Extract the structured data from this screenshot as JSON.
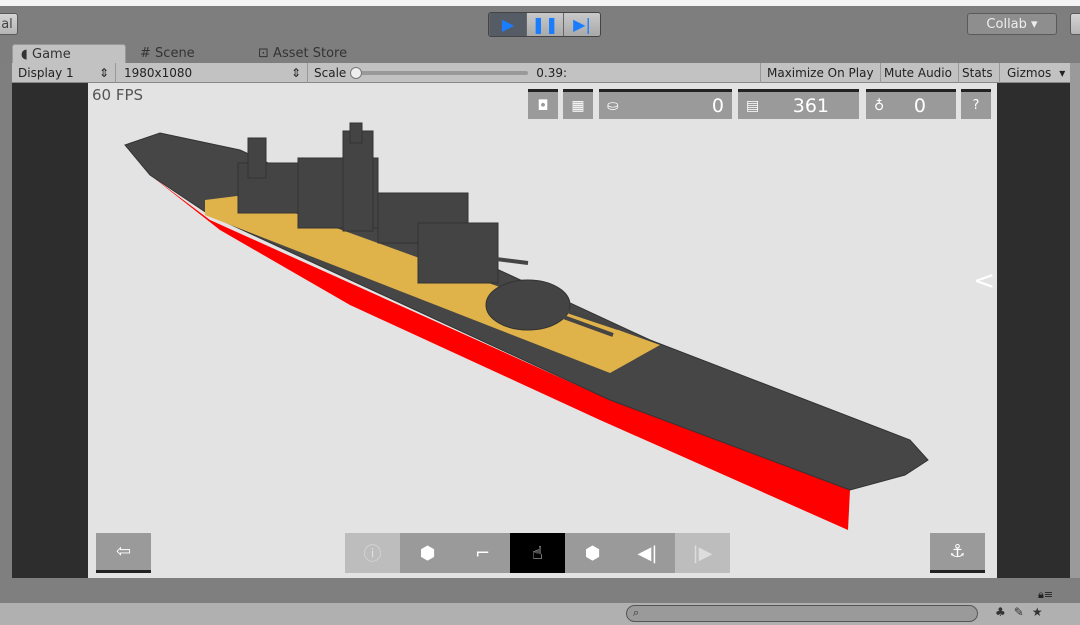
{
  "toolbar": {
    "left_button": "al",
    "collab": "Collab ▾",
    "play_icon": "play-icon",
    "pause_icon": "pause-icon",
    "step_icon": "step-icon"
  },
  "tabs": [
    {
      "label": "Game",
      "icon": "pacman-icon"
    },
    {
      "label": "Scene",
      "icon": "grid-icon"
    },
    {
      "label": "Asset Store",
      "icon": "bag-icon"
    }
  ],
  "game_toolbar": {
    "display": "Display 1",
    "resolution": "1980x1080",
    "scale_label": "Scale",
    "scale_value": "0.39:",
    "scale_fraction": 0.0,
    "maximize": "Maximize On Play",
    "mute": "Mute Audio",
    "stats": "Stats",
    "gizmos": "Gizmos"
  },
  "game": {
    "fps": "60 FPS",
    "counter1": "0",
    "counter2": "361",
    "counter3": "0",
    "help": "?"
  },
  "colors": {
    "deck": "#e0b24a",
    "hull": "#464646",
    "keel": "#ff0000",
    "bg": "#e3e3e3"
  }
}
